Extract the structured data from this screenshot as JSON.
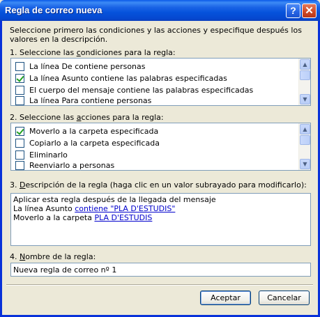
{
  "window": {
    "title": "Regla de correo nueva",
    "help_glyph": "?",
    "close_glyph": "✕"
  },
  "intro": "Seleccione primero las condiciones y las acciones y especifique después los valores en la descripción.",
  "conditions": {
    "label_pre": "1. Seleccione las ",
    "label_key": "c",
    "label_post": "ondiciones para la regla:",
    "items": [
      {
        "label": "La línea De contiene personas",
        "checked": false
      },
      {
        "label": "La línea Asunto contiene las palabras especificadas",
        "checked": true
      },
      {
        "label": "El cuerpo del mensaje contiene las palabras especificadas",
        "checked": false
      },
      {
        "label": "La línea Para contiene personas",
        "checked": false
      }
    ]
  },
  "actions": {
    "label_pre": "2. Seleccione las ",
    "label_key": "a",
    "label_post": "cciones para la regla:",
    "items": [
      {
        "label": "Moverlo a la carpeta especificada",
        "checked": true
      },
      {
        "label": "Copiarlo a la carpeta especificada",
        "checked": false
      },
      {
        "label": "Eliminarlo",
        "checked": false
      },
      {
        "label": "Reenviarlo a personas",
        "checked": false
      }
    ]
  },
  "description": {
    "label_pre": "3. ",
    "label_key": "D",
    "label_post": "escripción de la regla (haga clic en un valor subrayado para modificarlo):",
    "line1": "Aplicar esta regla después de la llegada del mensaje",
    "line2_pre": "La línea Asunto ",
    "line2_link": "contiene \"PLA D'ESTUDIS\"",
    "line3_pre": "Moverlo a la carpeta ",
    "line3_link": "PLA D'ESTUDIS"
  },
  "name": {
    "label_pre": "4. ",
    "label_key": "N",
    "label_post": "ombre de la regla:",
    "value": "Nueva regla de correo nº 1"
  },
  "buttons": {
    "ok": "Aceptar",
    "cancel": "Cancelar"
  },
  "colors": {
    "titlebar": "#0a5ae8",
    "dialog_bg": "#ece9d8",
    "link": "#0000cc",
    "check": "#21a121"
  }
}
